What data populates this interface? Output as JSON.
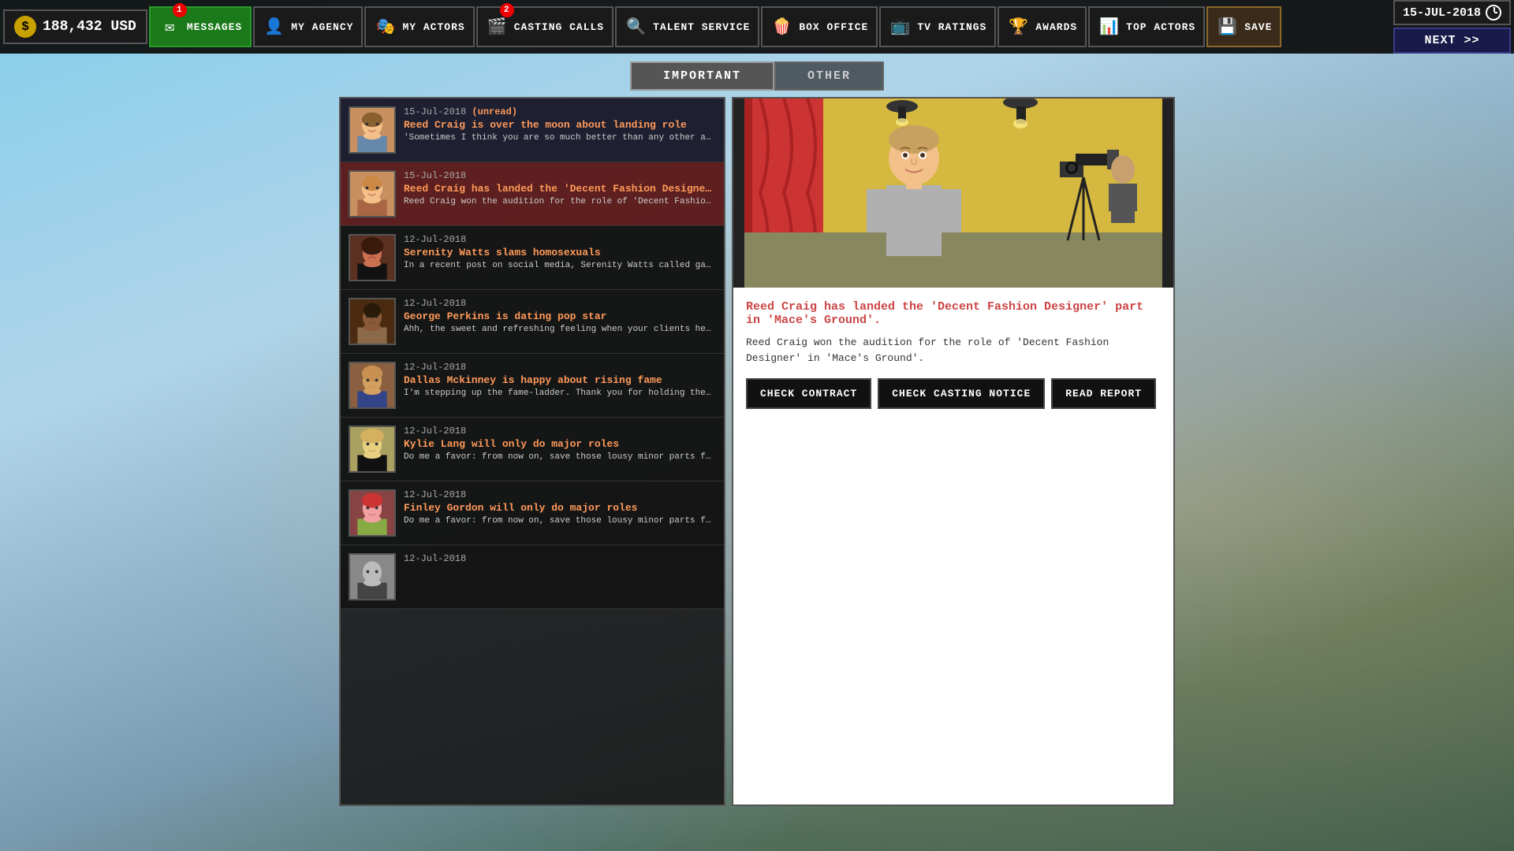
{
  "topbar": {
    "money": "188,432 USD",
    "currency_symbol": "$",
    "nav_buttons": [
      {
        "id": "messages",
        "label": "MESSAGES",
        "badge": 1,
        "icon": "✉"
      },
      {
        "id": "my-agency",
        "label": "MY AGENCY",
        "icon": "🏢"
      },
      {
        "id": "my-actors",
        "label": "MY ACTORS",
        "icon": "🎭"
      },
      {
        "id": "casting-calls",
        "label": "CASTING CALLS",
        "badge": 2,
        "icon": "🎬"
      },
      {
        "id": "talent-service",
        "label": "TALENT SERVICE",
        "icon": "🔍"
      },
      {
        "id": "box-office",
        "label": "BOX OFFICE",
        "icon": "🍿"
      },
      {
        "id": "tv-ratings",
        "label": "TV RATINGS",
        "icon": "📺"
      },
      {
        "id": "awards",
        "label": "AWARDS",
        "icon": "🏆"
      },
      {
        "id": "top-actors",
        "label": "TOP ACTORS",
        "icon": "📊"
      },
      {
        "id": "save",
        "label": "SAVE",
        "icon": "💾"
      }
    ],
    "date": "15-JUL-2018",
    "next_label": "NEXT >>"
  },
  "tabs": [
    {
      "id": "important",
      "label": "IMPORTANT",
      "active": true
    },
    {
      "id": "other",
      "label": "OTHER",
      "active": false
    }
  ],
  "messages": [
    {
      "id": 1,
      "date": "15-Jul-2018",
      "unread": true,
      "unread_label": "(unread)",
      "title": "Reed Craig is over the moon about landing role",
      "preview": "'Sometimes I think you are so much better than any other agents in t...",
      "avatar_class": "avatar-reed1",
      "selected": false
    },
    {
      "id": 2,
      "date": "15-Jul-2018",
      "unread": false,
      "title": "Reed Craig has landed the 'Decent Fashion Designer' part...",
      "preview": "Reed Craig won the audition for the role of 'Decent Fashion Designer' i...",
      "avatar_class": "avatar-reed2",
      "selected": true
    },
    {
      "id": 3,
      "date": "12-Jul-2018",
      "unread": false,
      "title": "Serenity Watts slams homosexuals",
      "preview": "In a recent post on social media, Serenity Watts called gay people 'fuck...",
      "avatar_class": "avatar-serenity",
      "selected": false
    },
    {
      "id": 4,
      "date": "12-Jul-2018",
      "unread": false,
      "title": "George Perkins is dating pop star",
      "preview": "Ahh, the sweet and refreshing feeling when your clients help you in bui...",
      "avatar_class": "avatar-george",
      "selected": false
    },
    {
      "id": 5,
      "date": "12-Jul-2018",
      "unread": false,
      "title": "Dallas Mckinney is happy about rising fame",
      "preview": "I'm stepping up the fame-ladder. Thank you for holding the ladder, you ...",
      "avatar_class": "avatar-dallas",
      "selected": false
    },
    {
      "id": 6,
      "date": "12-Jul-2018",
      "unread": false,
      "title": "Kylie Lang will only do major roles",
      "preview": "Do me a favor: from now on, save those lousy minor parts for sorry-...",
      "avatar_class": "avatar-kylie",
      "selected": false
    },
    {
      "id": 7,
      "date": "12-Jul-2018",
      "unread": false,
      "title": "Finley Gordon will only do major roles",
      "preview": "Do me a favor: from now on, save those lousy minor parts for sorry-...",
      "avatar_class": "avatar-finley",
      "selected": false
    },
    {
      "id": 8,
      "date": "12-Jul-2018",
      "unread": false,
      "title": "",
      "preview": "",
      "avatar_class": "avatar-extra",
      "selected": false
    }
  ],
  "detail": {
    "title": "Reed Craig has landed the 'Decent Fashion Designer' part in 'Mace's Ground'.",
    "body": "Reed Craig won the audition for the role of 'Decent Fashion Designer' in 'Mace's Ground'.",
    "actions": [
      {
        "id": "check-contract",
        "label": "CHECK  CONTRACT"
      },
      {
        "id": "check-casting-notice",
        "label": "CHECK  CASTING NOTICE"
      },
      {
        "id": "read-report",
        "label": "READ  REPORT"
      }
    ]
  }
}
